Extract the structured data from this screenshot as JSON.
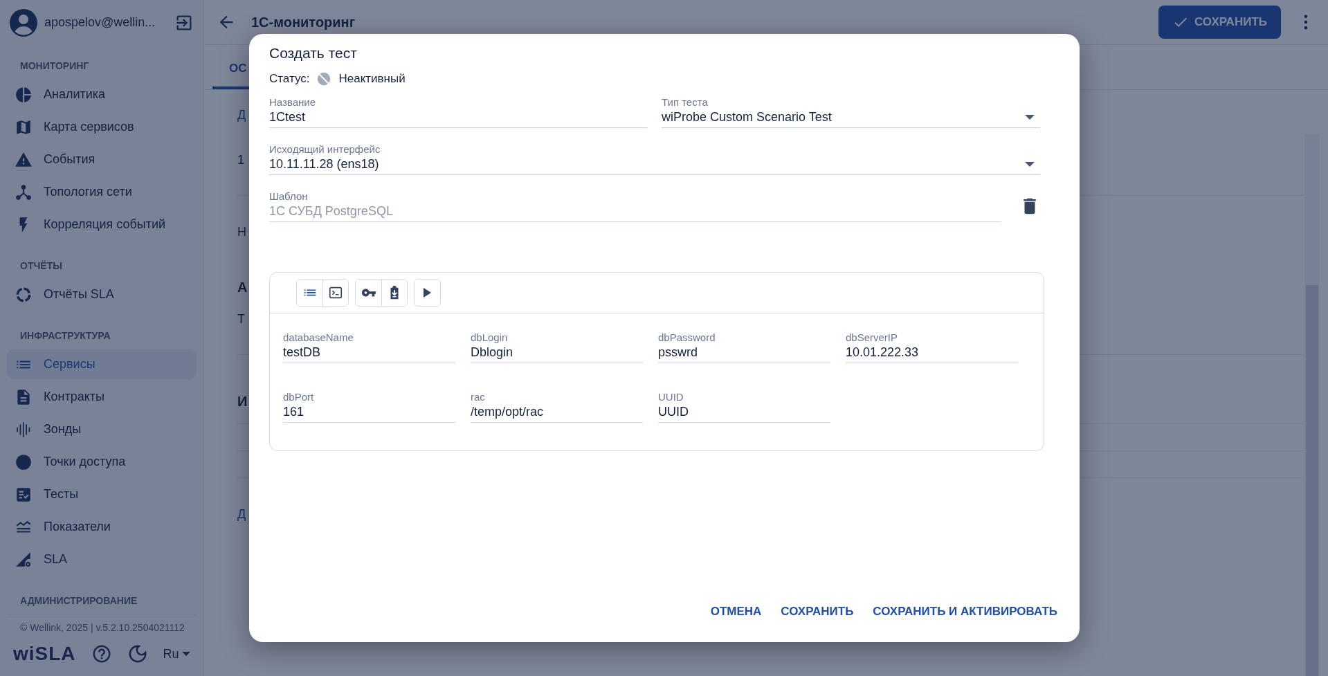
{
  "sidebar": {
    "user": "apospelov@wellin...",
    "sections": [
      {
        "title": "МОНИТОРИНГ",
        "items": [
          {
            "label": "Аналитика",
            "selected": false
          },
          {
            "label": "Карта сервисов",
            "selected": false
          },
          {
            "label": "События",
            "selected": false
          },
          {
            "label": "Топология сети",
            "selected": false
          },
          {
            "label": "Корреляция событий",
            "selected": false
          }
        ]
      },
      {
        "title": "ОТЧЁТЫ",
        "items": [
          {
            "label": "Отчёты SLA",
            "selected": false
          }
        ]
      },
      {
        "title": "ИНФРАСТРУКТУРА",
        "items": [
          {
            "label": "Сервисы",
            "selected": true
          },
          {
            "label": "Контракты",
            "selected": false
          },
          {
            "label": "Зонды",
            "selected": false
          },
          {
            "label": "Точки доступа",
            "selected": false
          },
          {
            "label": "Тесты",
            "selected": false
          },
          {
            "label": "Показатели",
            "selected": false
          },
          {
            "label": "SLA",
            "selected": false
          }
        ]
      },
      {
        "title": "АДМИНИСТРИРОВАНИЕ"
      }
    ],
    "footer": "© Wellink, 2025 | v.5.2.10.2504021112",
    "logo": "wiSLA",
    "language": "Ru"
  },
  "topbar": {
    "title": "1С-мониторинг",
    "save_button": "СОХРАНИТЬ"
  },
  "page": {
    "tab": "ОС",
    "fragments": [
      {
        "kind": "link",
        "text": "Д"
      },
      {
        "kind": "text",
        "text": "1"
      },
      {
        "kind": "rule"
      },
      {
        "kind": "text",
        "text": "Н"
      },
      {
        "kind": "heading",
        "text": "А"
      },
      {
        "kind": "text",
        "text": "Т"
      },
      {
        "kind": "rule"
      },
      {
        "kind": "heading",
        "text": "И"
      },
      {
        "kind": "rule"
      },
      {
        "kind": "rule"
      },
      {
        "kind": "rule"
      },
      {
        "kind": "link",
        "text": "Д"
      }
    ]
  },
  "dialog": {
    "title": "Создать тест",
    "status": {
      "label": "Статус:",
      "value": "Неактивный",
      "active": false
    },
    "fields": [
      {
        "kind": "text",
        "label": "Название",
        "value": "1Ctest",
        "disabled": false
      },
      {
        "kind": "select",
        "label": "Тип теста",
        "value": "wiProbe Custom Scenario Test",
        "disabled": false
      },
      {
        "kind": "select",
        "label": "Исходящий интерфейс",
        "value": "10.11.11.28 (ens18)",
        "disabled": false
      },
      {
        "kind": "text",
        "label": "Шаблон",
        "value": "1С СУБД PostgreSQL",
        "disabled": true
      }
    ],
    "toolbar": [
      {
        "buttons": [
          {
            "selected": true
          },
          {
            "selected": false
          }
        ]
      },
      {
        "buttons": [
          {
            "selected": false
          },
          {
            "selected": false
          }
        ]
      },
      {
        "buttons": [
          {
            "selected": false
          }
        ]
      }
    ],
    "params": [
      {
        "label": "databaseName",
        "value": "testDB"
      },
      {
        "label": "dbLogin",
        "value": "Dblogin"
      },
      {
        "label": "dbPassword",
        "value": "psswrd"
      },
      {
        "label": "dbServerIP",
        "value": "10.01.222.33"
      },
      {
        "label": "dbPort",
        "value": "161"
      },
      {
        "label": "rac",
        "value": "/temp/opt/rac"
      },
      {
        "label": "UUID",
        "value": "UUID"
      }
    ],
    "actions": [
      "ОТМЕНА",
      "СОХРАНИТЬ",
      "СОХРАНИТЬ И АКТИВИРОВАТЬ"
    ]
  }
}
